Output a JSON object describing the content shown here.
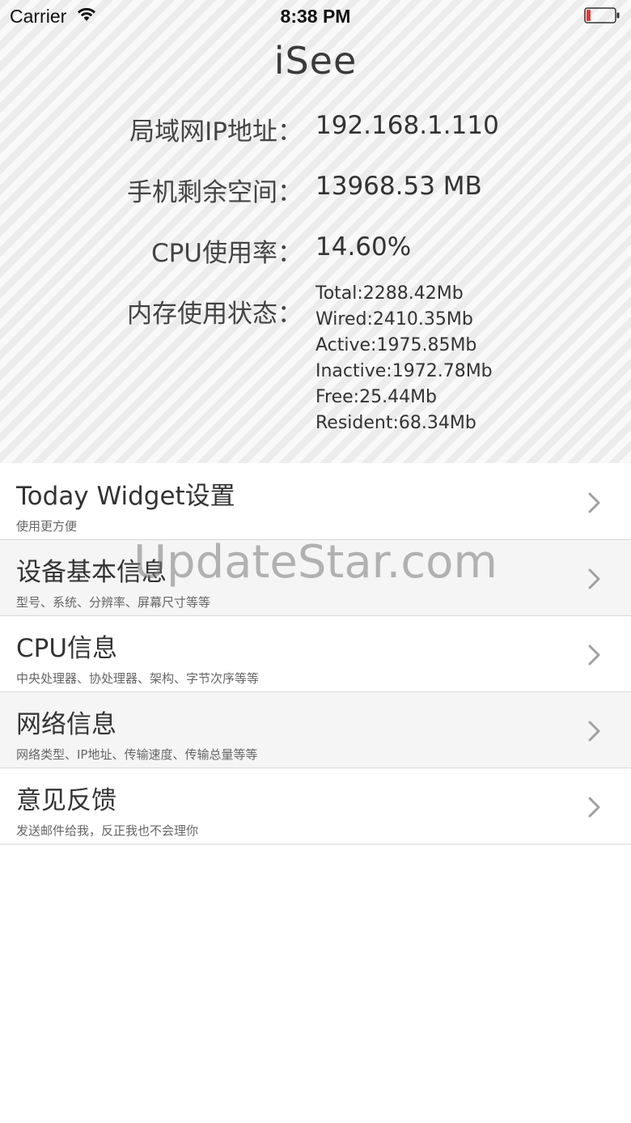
{
  "status_bar": {
    "carrier": "Carrier",
    "time": "8:38 PM",
    "wifi_icon": "wifi-icon",
    "battery_icon": "battery-icon",
    "battery_color": "#e53935"
  },
  "app": {
    "title": "iSee"
  },
  "info": {
    "ip_label": "局域网IP地址：",
    "ip_value": "192.168.1.110",
    "space_label": "手机剩余空间：",
    "space_value": "13968.53 MB",
    "cpu_label": "CPU使用率：",
    "cpu_value": "14.60%",
    "memory_label": "内存使用状态：",
    "memory": [
      "Total:2288.42Mb",
      "Wired:2410.35Mb",
      "Active:1975.85Mb",
      "Inactive:1972.78Mb",
      "Free:25.44Mb",
      "Resident:68.34Mb"
    ]
  },
  "menu": [
    {
      "title": "Today Widget设置",
      "subtitle": "使用更方便"
    },
    {
      "title": "设备基本信息",
      "subtitle": "型号、系统、分辨率、屏幕尺寸等等"
    },
    {
      "title": "CPU信息",
      "subtitle": "中央处理器、协处理器、架构、字节次序等等"
    },
    {
      "title": "网络信息",
      "subtitle": "网络类型、IP地址、传输速度、传输总量等等"
    },
    {
      "title": "意见反馈",
      "subtitle": "发送邮件给我，反正我也不会理你"
    }
  ],
  "chevron_icon": "chevron-right-icon",
  "watermark": "UpdateStar.com"
}
